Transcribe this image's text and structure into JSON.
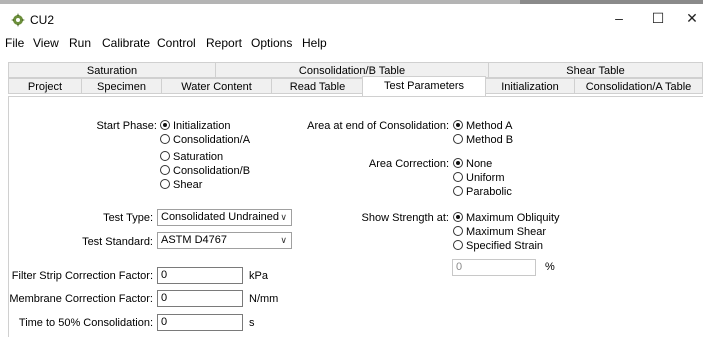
{
  "window": {
    "title": "CU2",
    "app_icon": "gear-leaf-icon",
    "minimize": "–",
    "maximize": "☐",
    "close": "✕"
  },
  "menu": [
    "File",
    "View",
    "Run",
    "Calibrate",
    "Control",
    "Report",
    "Options",
    "Help"
  ],
  "tabs": {
    "row1": [
      "Saturation",
      "Consolidation/B Table",
      "Shear Table"
    ],
    "row2": [
      "Project",
      "Specimen",
      "Water Content",
      "Read Table",
      "Test Parameters",
      "Initialization",
      "Consolidation/A Table"
    ],
    "active": "Test Parameters"
  },
  "start_phase": {
    "label": "Start Phase:",
    "options": [
      "Initialization",
      "Consolidation/A",
      "Saturation",
      "Consolidation/B",
      "Shear"
    ],
    "selected": "Initialization"
  },
  "area_end": {
    "label": "Area at end of Consolidation:",
    "options": [
      "Method A",
      "Method B"
    ],
    "selected": "Method A"
  },
  "area_correction": {
    "label": "Area Correction:",
    "options": [
      "None",
      "Uniform",
      "Parabolic"
    ],
    "selected": "None"
  },
  "test_type": {
    "label": "Test Type:",
    "value": "Consolidated Undrained"
  },
  "test_standard": {
    "label": "Test Standard:",
    "value": "ASTM D4767"
  },
  "show_strength": {
    "label": "Show Strength at:",
    "options": [
      "Maximum Obliquity",
      "Maximum Shear",
      "Specified Strain"
    ],
    "selected": "Maximum Obliquity",
    "strain_value": "0",
    "strain_unit": "%"
  },
  "filter_strip": {
    "label": "Filter Strip Correction Factor:",
    "value": "0",
    "unit": "kPa"
  },
  "membrane": {
    "label": "Membrane Correction Factor:",
    "value": "0",
    "unit": "N/mm"
  },
  "time50": {
    "label": "Time to 50% Consolidation:",
    "value": "0",
    "unit": "s"
  }
}
